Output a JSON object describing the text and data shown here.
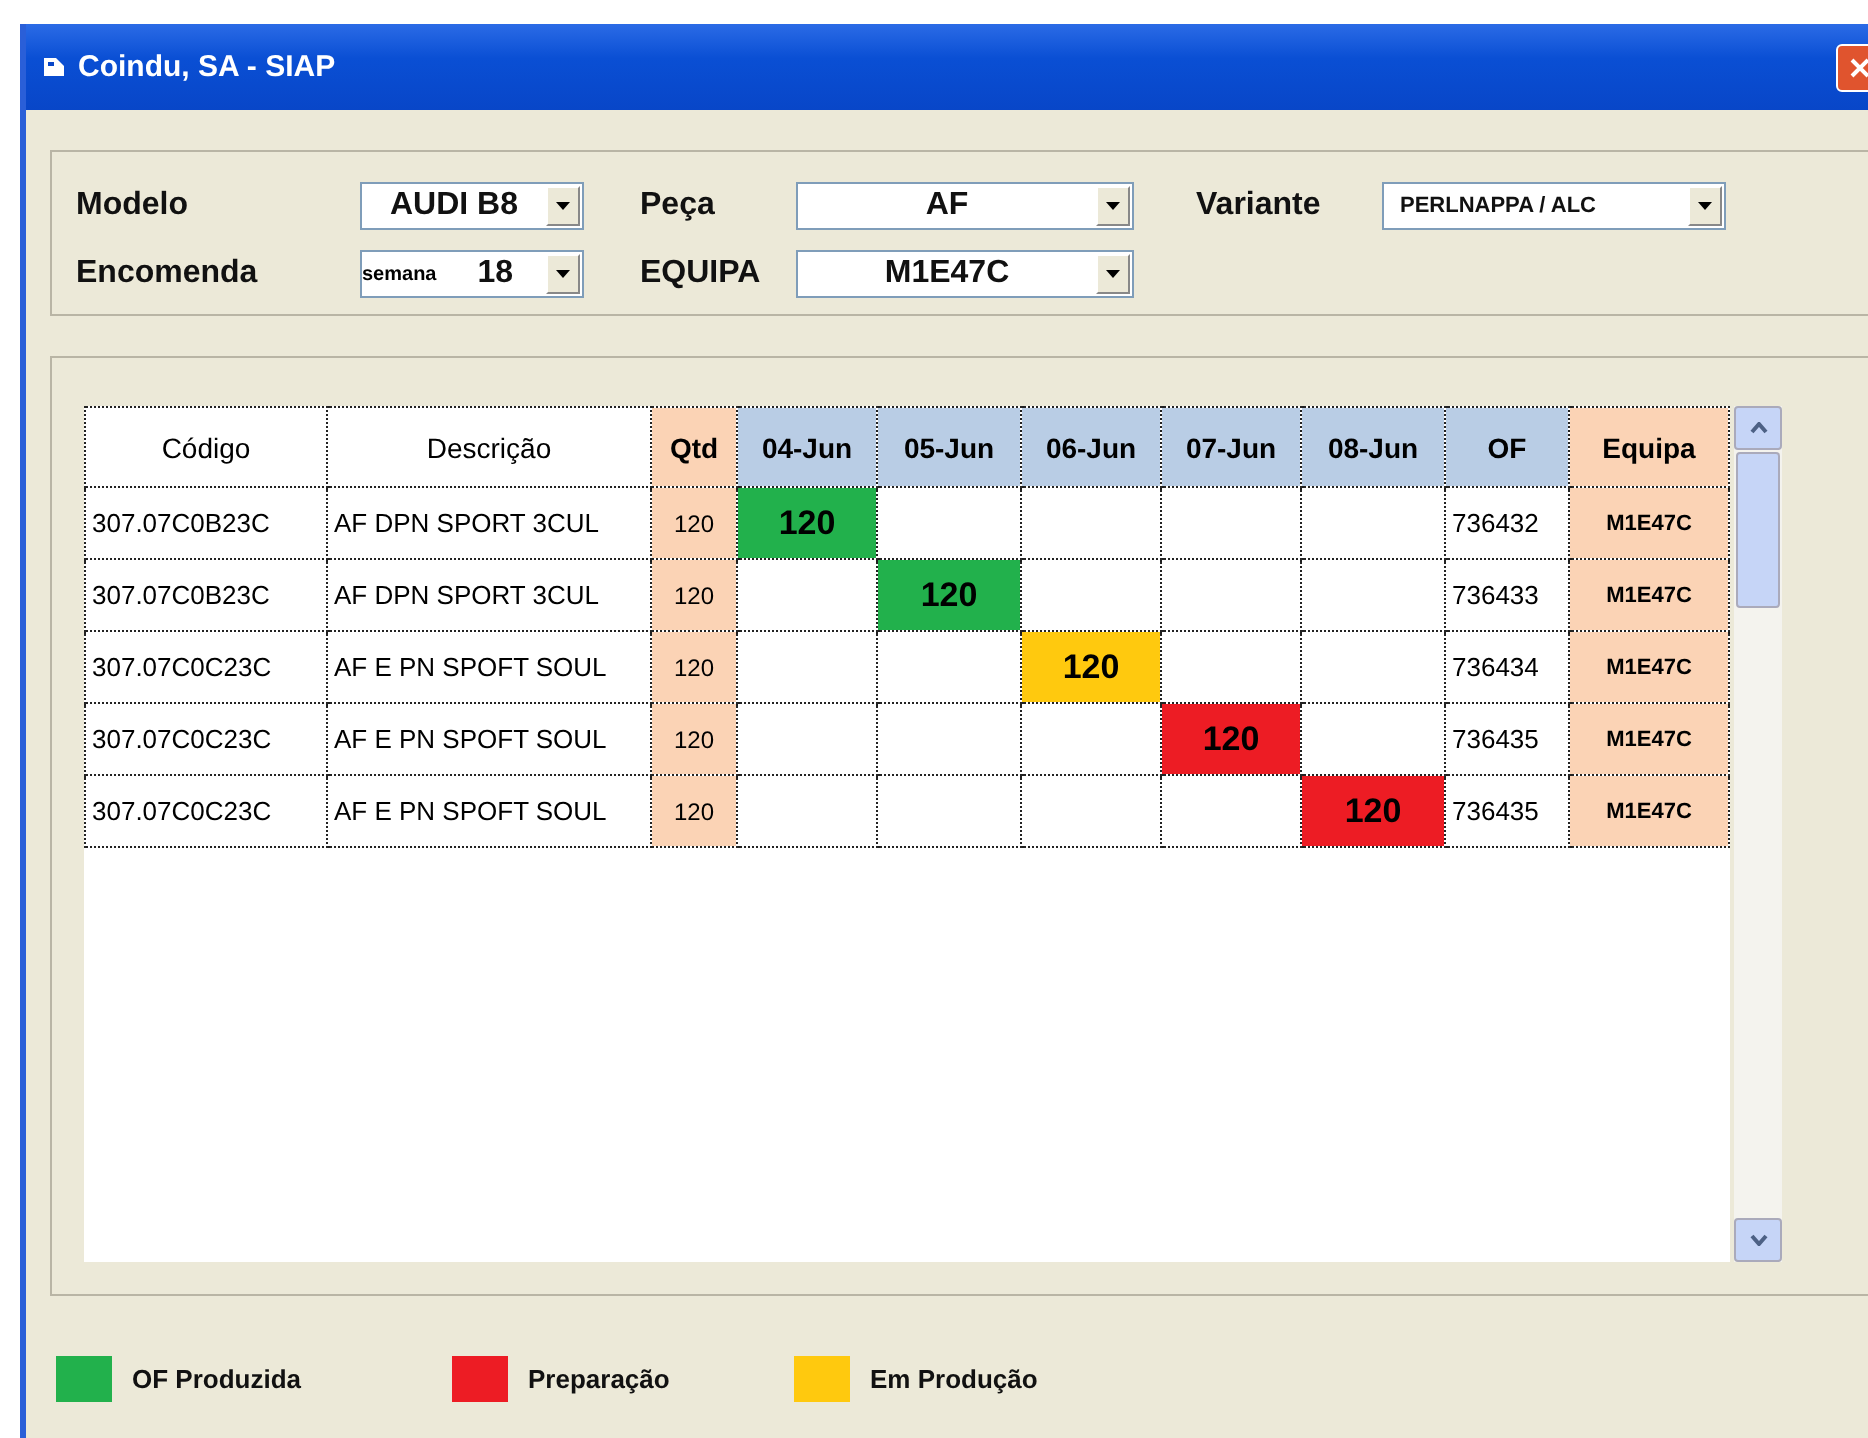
{
  "window": {
    "title": "Coindu, SA - SIAP"
  },
  "filters": [
    {
      "label": "Modelo",
      "value": "AUDI B8"
    },
    {
      "label": "Peça",
      "value": "AF"
    },
    {
      "label": "Variante",
      "value": "PERLNAPPA / ALC"
    },
    {
      "label": "Encomenda",
      "prefix": "semana",
      "value": "18"
    },
    {
      "label": "EQUIPA",
      "value": "M1E47C"
    }
  ],
  "table": {
    "columns": [
      "Código",
      "Descrição",
      "Qtd",
      "04-Jun",
      "05-Jun",
      "06-Jun",
      "07-Jun",
      "08-Jun",
      "OF",
      "Equipa"
    ],
    "rows": [
      {
        "codigo": "307.07C0B23C",
        "descricao": "AF DPN SPORT 3CUL",
        "qtd": "120",
        "days": [
          {
            "filled": true,
            "value": "120",
            "color": "#22b14c"
          },
          {
            "filled": false
          },
          {
            "filled": false
          },
          {
            "filled": false
          },
          {
            "filled": false
          }
        ],
        "of": "736432",
        "equipa": "M1E47C"
      },
      {
        "codigo": "307.07C0B23C",
        "descricao": "AF DPN SPORT 3CUL",
        "qtd": "120",
        "days": [
          {
            "filled": false
          },
          {
            "filled": true,
            "value": "120",
            "color": "#22b14c"
          },
          {
            "filled": false
          },
          {
            "filled": false
          },
          {
            "filled": false
          }
        ],
        "of": "736433",
        "equipa": "M1E47C"
      },
      {
        "codigo": "307.07C0C23C",
        "descricao": "AF E PN SPOFT SOUL",
        "qtd": "120",
        "days": [
          {
            "filled": false
          },
          {
            "filled": false
          },
          {
            "filled": true,
            "value": "120",
            "color": "#ffc90e"
          },
          {
            "filled": false
          },
          {
            "filled": false
          }
        ],
        "of": "736434",
        "equipa": "M1E47C"
      },
      {
        "codigo": "307.07C0C23C",
        "descricao": "AF E PN SPOFT SOUL",
        "qtd": "120",
        "days": [
          {
            "filled": false
          },
          {
            "filled": false
          },
          {
            "filled": false
          },
          {
            "filled": true,
            "value": "120",
            "color": "#ed1c24"
          },
          {
            "filled": false
          }
        ],
        "of": "736435",
        "equipa": "M1E47C"
      },
      {
        "codigo": "307.07C0C23C",
        "descricao": "AF E PN SPOFT SOUL",
        "qtd": "120",
        "days": [
          {
            "filled": false
          },
          {
            "filled": false
          },
          {
            "filled": false
          },
          {
            "filled": false
          },
          {
            "filled": true,
            "value": "120",
            "color": "#ed1c24"
          }
        ],
        "of": "736435",
        "equipa": "M1E47C"
      }
    ]
  },
  "legend": [
    {
      "label": "OF Produzida",
      "color": "#22b14c"
    },
    {
      "label": "Preparação",
      "color": "#ed1c24"
    },
    {
      "label": "Em Produção",
      "color": "#ffc90e"
    }
  ]
}
